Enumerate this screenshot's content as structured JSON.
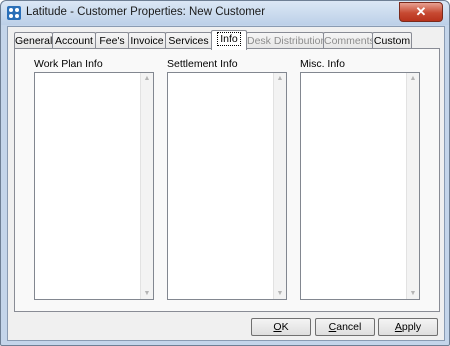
{
  "window": {
    "title": "Latitude - Customer Properties: New Customer",
    "close_label": "✕"
  },
  "tabs": [
    {
      "label": "General",
      "state": "normal"
    },
    {
      "label": "Account",
      "state": "normal"
    },
    {
      "label": "Fee's",
      "state": "normal"
    },
    {
      "label": "Invoice",
      "state": "normal"
    },
    {
      "label": "Services",
      "state": "normal"
    },
    {
      "label": "Info",
      "state": "active"
    },
    {
      "label": "Desk Distribution",
      "state": "disabled"
    },
    {
      "label": "Comments",
      "state": "disabled"
    },
    {
      "label": "Custom",
      "state": "normal"
    }
  ],
  "sections": [
    {
      "label": "Work Plan Info"
    },
    {
      "label": "Settlement Info"
    },
    {
      "label": "Misc. Info"
    }
  ],
  "buttons": {
    "ok": {
      "mnemonic": "O",
      "rest": "K"
    },
    "cancel": {
      "mnemonic": "C",
      "rest": "ancel"
    },
    "apply": {
      "mnemonic": "A",
      "rest": "pply"
    }
  },
  "icons": {
    "app": "latitude-app-icon",
    "close": "close-icon",
    "scroll_up": "scroll-up-arrow-icon",
    "scroll_down": "scroll-down-arrow-icon"
  },
  "colors": {
    "title_bar": "#c4d5ea",
    "close_button": "#c74a32",
    "disabled_text": "#8d8d8d"
  }
}
